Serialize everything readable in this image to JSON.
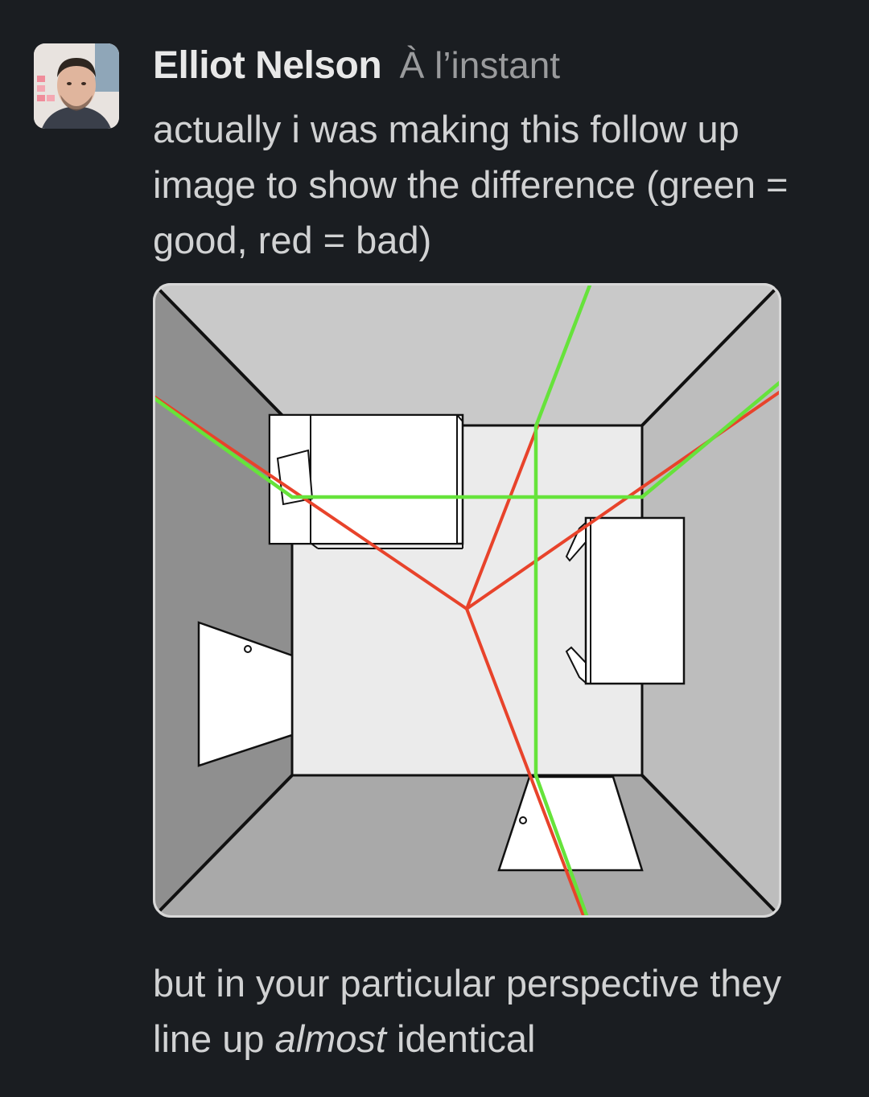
{
  "message": {
    "author": "Elliot Nelson",
    "timestamp": "À l’instant",
    "text_1": "actually i was making this follow up image to show the difference (green = good, red = bad)",
    "text_2": {
      "before": "but in your particular perspective they line up ",
      "emphasis": "almost",
      "after": " identical"
    }
  },
  "colors": {
    "background": "#1a1d21",
    "good_line": "#66e33b",
    "bad_line": "#e8432b"
  }
}
